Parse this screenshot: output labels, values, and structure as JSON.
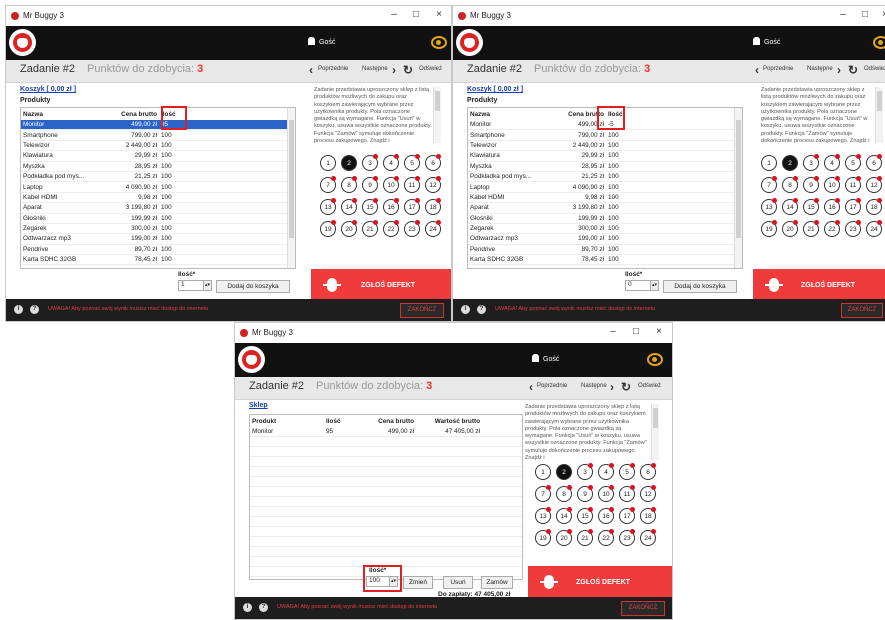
{
  "common": {
    "app_title": "Mr Buggy 3",
    "user": "Gość",
    "task_label": "Zadanie #2",
    "points_label": "Punktów do zdobycia:",
    "points_value": "3",
    "prev": "Poprzednie",
    "next": "Następne",
    "refresh": "Odśwież",
    "description": "Zadanie przedstawia uproszczony sklep z listą produktów możliwych do zakupu oraz koszykiem zawierającym wybrane przez użytkownika produkty. Pola oznaczone gwiazdką są wymagane. Funkcja \"Usuń\" w koszyku, usuwa wszystkie oznaczone produkty. Funkcja \"Zamów\" symuluje dokończenie procesu zakupowego. Znajdź i",
    "defect_label": "ZGŁOŚ DEFEKT",
    "footer_warning": "UWAGA! Aby poznać swój wynik musisz mieć dostęp do internetu",
    "finish": "ZAKOŃCZ",
    "task_numbers": [
      "1",
      "2",
      "3",
      "4",
      "5",
      "6",
      "7",
      "8",
      "9",
      "10",
      "11",
      "12",
      "13",
      "14",
      "15",
      "16",
      "17",
      "18",
      "19",
      "20",
      "21",
      "22",
      "23",
      "24"
    ]
  },
  "w1": {
    "cart_link": "Koszyk [ 0,00 zł ]",
    "products_label": "Produkty",
    "headers": [
      "Nazwa",
      "Cena brutto",
      "Ilość"
    ],
    "rows": [
      [
        "Monitor",
        "499,00 zł",
        "95"
      ],
      [
        "Smartphone",
        "799,00 zł",
        "100"
      ],
      [
        "Telewizor",
        "2 449,00 zł",
        "100"
      ],
      [
        "Klawiatura",
        "29,99 zł",
        "100"
      ],
      [
        "Myszka",
        "28,95 zł",
        "100"
      ],
      [
        "Podkładka pod mys...",
        "21,25 zł",
        "100"
      ],
      [
        "Laptop",
        "4 090,90 zł",
        "100"
      ],
      [
        "Kabel HDMI",
        "9,98 zł",
        "100"
      ],
      [
        "Aparat",
        "3 199,80 zł",
        "100"
      ],
      [
        "Głośniki",
        "199,99 zł",
        "100"
      ],
      [
        "Zegarek",
        "300,00 zł",
        "100"
      ],
      [
        "Odtwarzacz mp3",
        "199,00 zł",
        "100"
      ],
      [
        "Pendrive",
        "89,70 zł",
        "100"
      ],
      [
        "Karta SDHC 32GB",
        "78,45 zł",
        "100"
      ]
    ],
    "qty_label": "Ilość*",
    "qty_value": "1",
    "add_button": "Dodaj do koszyka"
  },
  "w2": {
    "cart_link": "Koszyk [ 0,00 zł ]",
    "products_label": "Produkty",
    "headers": [
      "Nazwa",
      "Cena brutto",
      "Ilość"
    ],
    "rows": [
      [
        "Monitor",
        "499,00 zł",
        "-5"
      ],
      [
        "Smartphone",
        "799,00 zł",
        "100"
      ],
      [
        "Telewizor",
        "2 449,00 zł",
        "100"
      ],
      [
        "Klawiatura",
        "29,99 zł",
        "100"
      ],
      [
        "Myszka",
        "28,95 zł",
        "100"
      ],
      [
        "Podkładka pod mys...",
        "21,25 zł",
        "100"
      ],
      [
        "Laptop",
        "4 090,90 zł",
        "100"
      ],
      [
        "Kabel HDMI",
        "9,98 zł",
        "100"
      ],
      [
        "Aparat",
        "3 199,80 zł",
        "100"
      ],
      [
        "Głośniki",
        "199,99 zł",
        "100"
      ],
      [
        "Zegarek",
        "300,00 zł",
        "100"
      ],
      [
        "Odtwarzacz mp3",
        "199,00 zł",
        "100"
      ],
      [
        "Pendrive",
        "89,70 zł",
        "100"
      ],
      [
        "Karta SDHC 32GB",
        "78,45 zł",
        "100"
      ]
    ],
    "qty_label": "Ilość*",
    "qty_value": "0",
    "add_button": "Dodaj do koszyka"
  },
  "w3": {
    "shop_link": "Sklep",
    "headers": [
      "Produkt",
      "Ilość",
      "Cena brutto",
      "Wartość brutto"
    ],
    "rows": [
      [
        "Monitor",
        "95",
        "499,00 zł",
        "47 405,00 zł"
      ]
    ],
    "qty_label": "Ilość*",
    "qty_value": "100",
    "change_button": "Zmień",
    "remove_button": "Usuń",
    "order_button": "Zamów",
    "total_text": "Do zapłaty: 47 405,00 zł"
  }
}
